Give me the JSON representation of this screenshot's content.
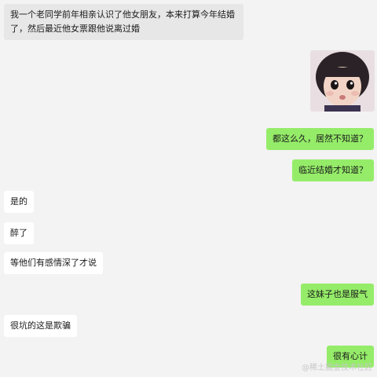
{
  "chat": {
    "messages": [
      {
        "side": "left",
        "text": "我一个老同学前年相亲认识了他女朋友，本来打算今年结婚了，然后最近他女票跟他说离过婚"
      },
      {
        "side": "right",
        "type": "sticker",
        "icon": "sticker-baby-face-icon"
      },
      {
        "side": "right",
        "text": "都这么久，居然不知道？"
      },
      {
        "side": "right",
        "text": "临近结婚才知道？"
      },
      {
        "side": "left",
        "text": "是的"
      },
      {
        "side": "left",
        "text": "醉了"
      },
      {
        "side": "left",
        "text": "等他们有感情深了才说"
      },
      {
        "side": "right",
        "text": "这妹子也是服气"
      },
      {
        "side": "left",
        "text": "很坑的这是欺骗"
      },
      {
        "side": "right",
        "text": "很有心计"
      }
    ]
  },
  "colors": {
    "background": "#f3f3f3",
    "incoming_bubble": "#ffffff",
    "outgoing_bubble": "#95ec69",
    "first_bubble": "#e7e7e7"
  },
  "watermark": "@稀土掘金技术社区"
}
